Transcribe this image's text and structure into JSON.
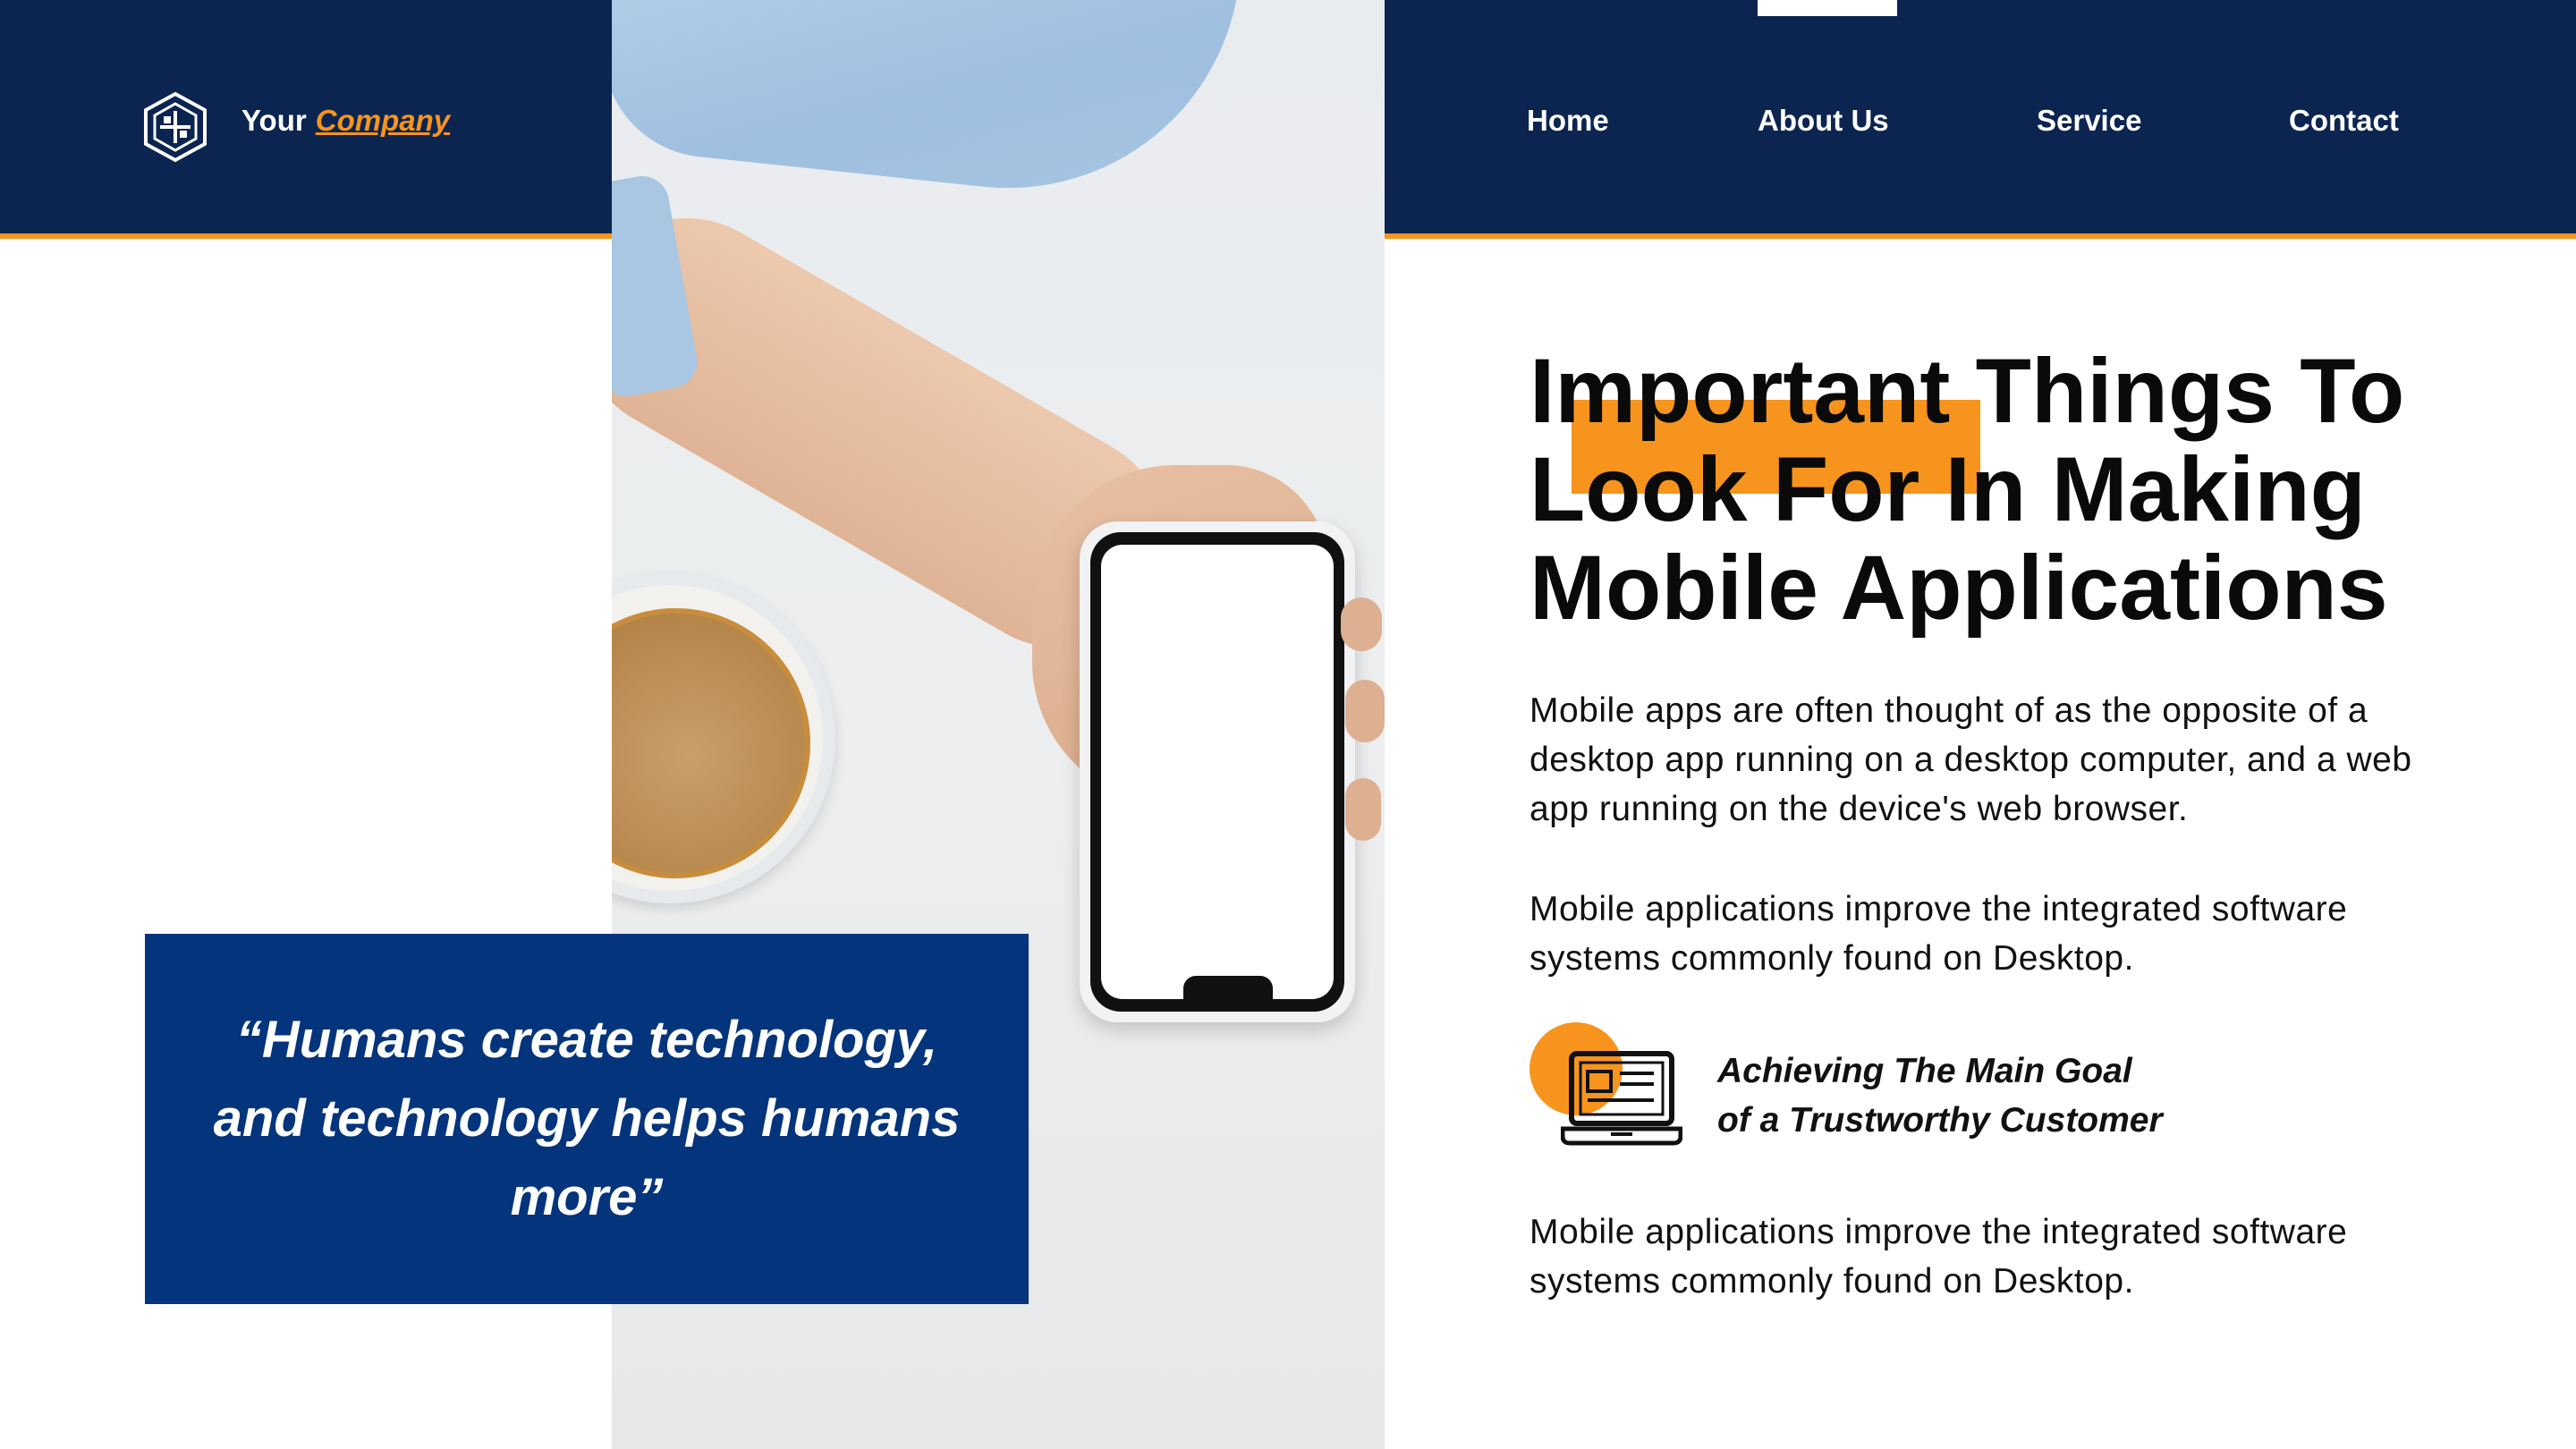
{
  "brand": {
    "prefix": "Your",
    "name": "Company"
  },
  "nav": {
    "items": [
      {
        "label": "Home"
      },
      {
        "label": "About Us",
        "active": true
      },
      {
        "label": "Service"
      },
      {
        "label": "Contact"
      }
    ]
  },
  "quote": "“Humans create technology, and technology helps humans more”",
  "main": {
    "title": "Important Things To Look For In Making Mobile Applications",
    "paragraph1": "Mobile apps are often thought of as the opposite of a desktop app running on a desktop computer, and a web app running on the device's web browser.",
    "paragraph2": "Mobile applications improve the integrated software systems commonly found on Desktop.",
    "goal_line1": "Achieving The Main Goal",
    "goal_line2": "of a Trustworthy Customer",
    "paragraph3": "Mobile applications improve the integrated software systems commonly found on Desktop."
  },
  "icons": {
    "logo": "shield-logo-icon",
    "goal": "laptop-icon"
  },
  "colors": {
    "navy": "#0b2550",
    "accent": "#f7941d",
    "quote_bg": "#03347c",
    "text": "#111111"
  }
}
